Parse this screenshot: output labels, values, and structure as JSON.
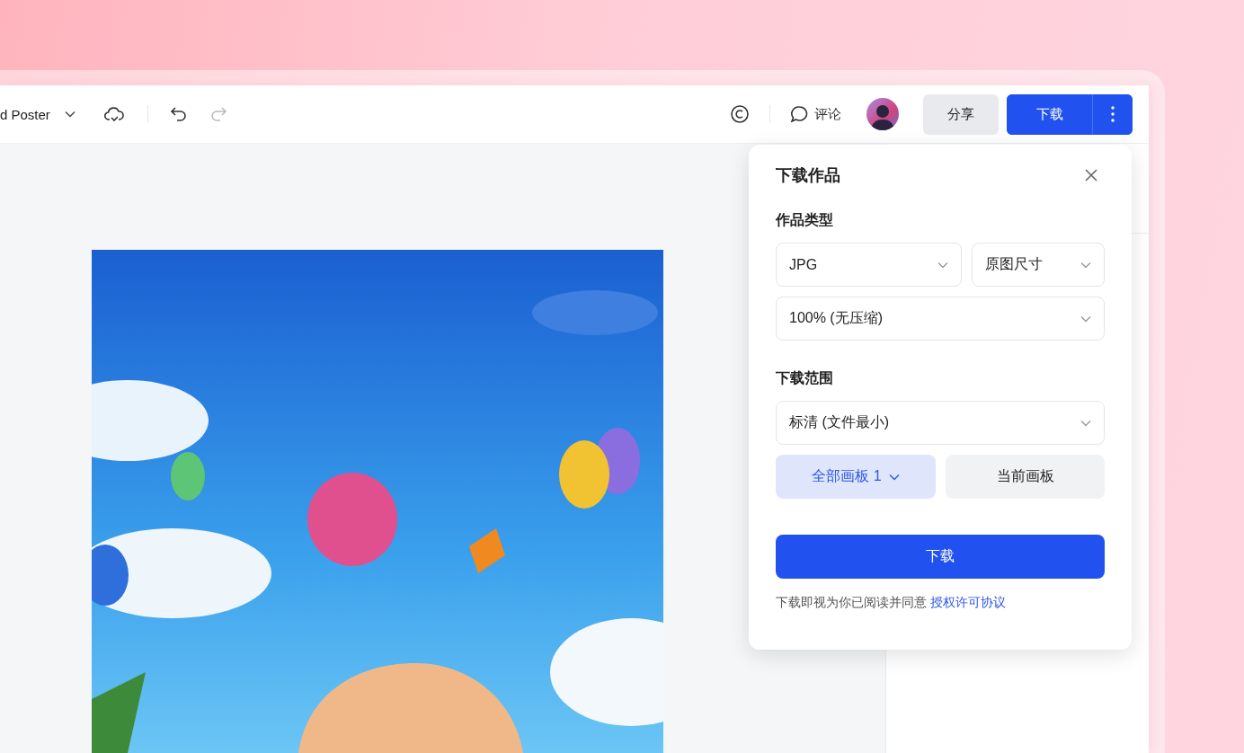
{
  "toolbar": {
    "document_title": "d Poster",
    "comment_label": "评论",
    "share_button": "分享",
    "download_button": "下载"
  },
  "download_panel": {
    "title": "下载作品",
    "sections": [
      {
        "label": "作品类型",
        "selects": [
          {
            "value": "JPG"
          },
          {
            "value": "原图尺寸"
          },
          {
            "value": "100% (无压缩)"
          }
        ]
      },
      {
        "label": "下载范围",
        "selects": [
          {
            "value": "标清 (文件最小)"
          }
        ],
        "options": [
          {
            "label": "全部画板 1",
            "selected": true,
            "dropdown": true
          },
          {
            "label": "当前画板",
            "selected": false,
            "dropdown": false
          }
        ]
      }
    ],
    "submit": "下载",
    "notice": "下载即视为你已阅读并同意",
    "notice_link": "授权许可协议"
  }
}
